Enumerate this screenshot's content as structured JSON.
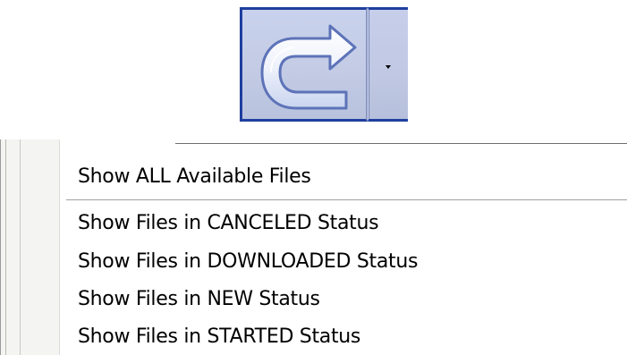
{
  "toolbar": {
    "redo_button": {
      "icon": "redo-icon",
      "has_dropdown": true,
      "dropdown_icon": "dropdown-arrow-icon"
    }
  },
  "menu": {
    "items": [
      {
        "label": "Show ALL Available Files"
      },
      {
        "label": "Show Files in CANCELED Status"
      },
      {
        "label": "Show Files in DOWNLOADED Status"
      },
      {
        "label": "Show Files in NEW Status"
      },
      {
        "label": "Show Files in STARTED Status"
      }
    ]
  },
  "colors": {
    "button_border": "#1f3f9f",
    "button_fill": "#c3cbe5",
    "menu_gutter": "#f4f4f2",
    "menu_separator": "#a0a0a0"
  }
}
